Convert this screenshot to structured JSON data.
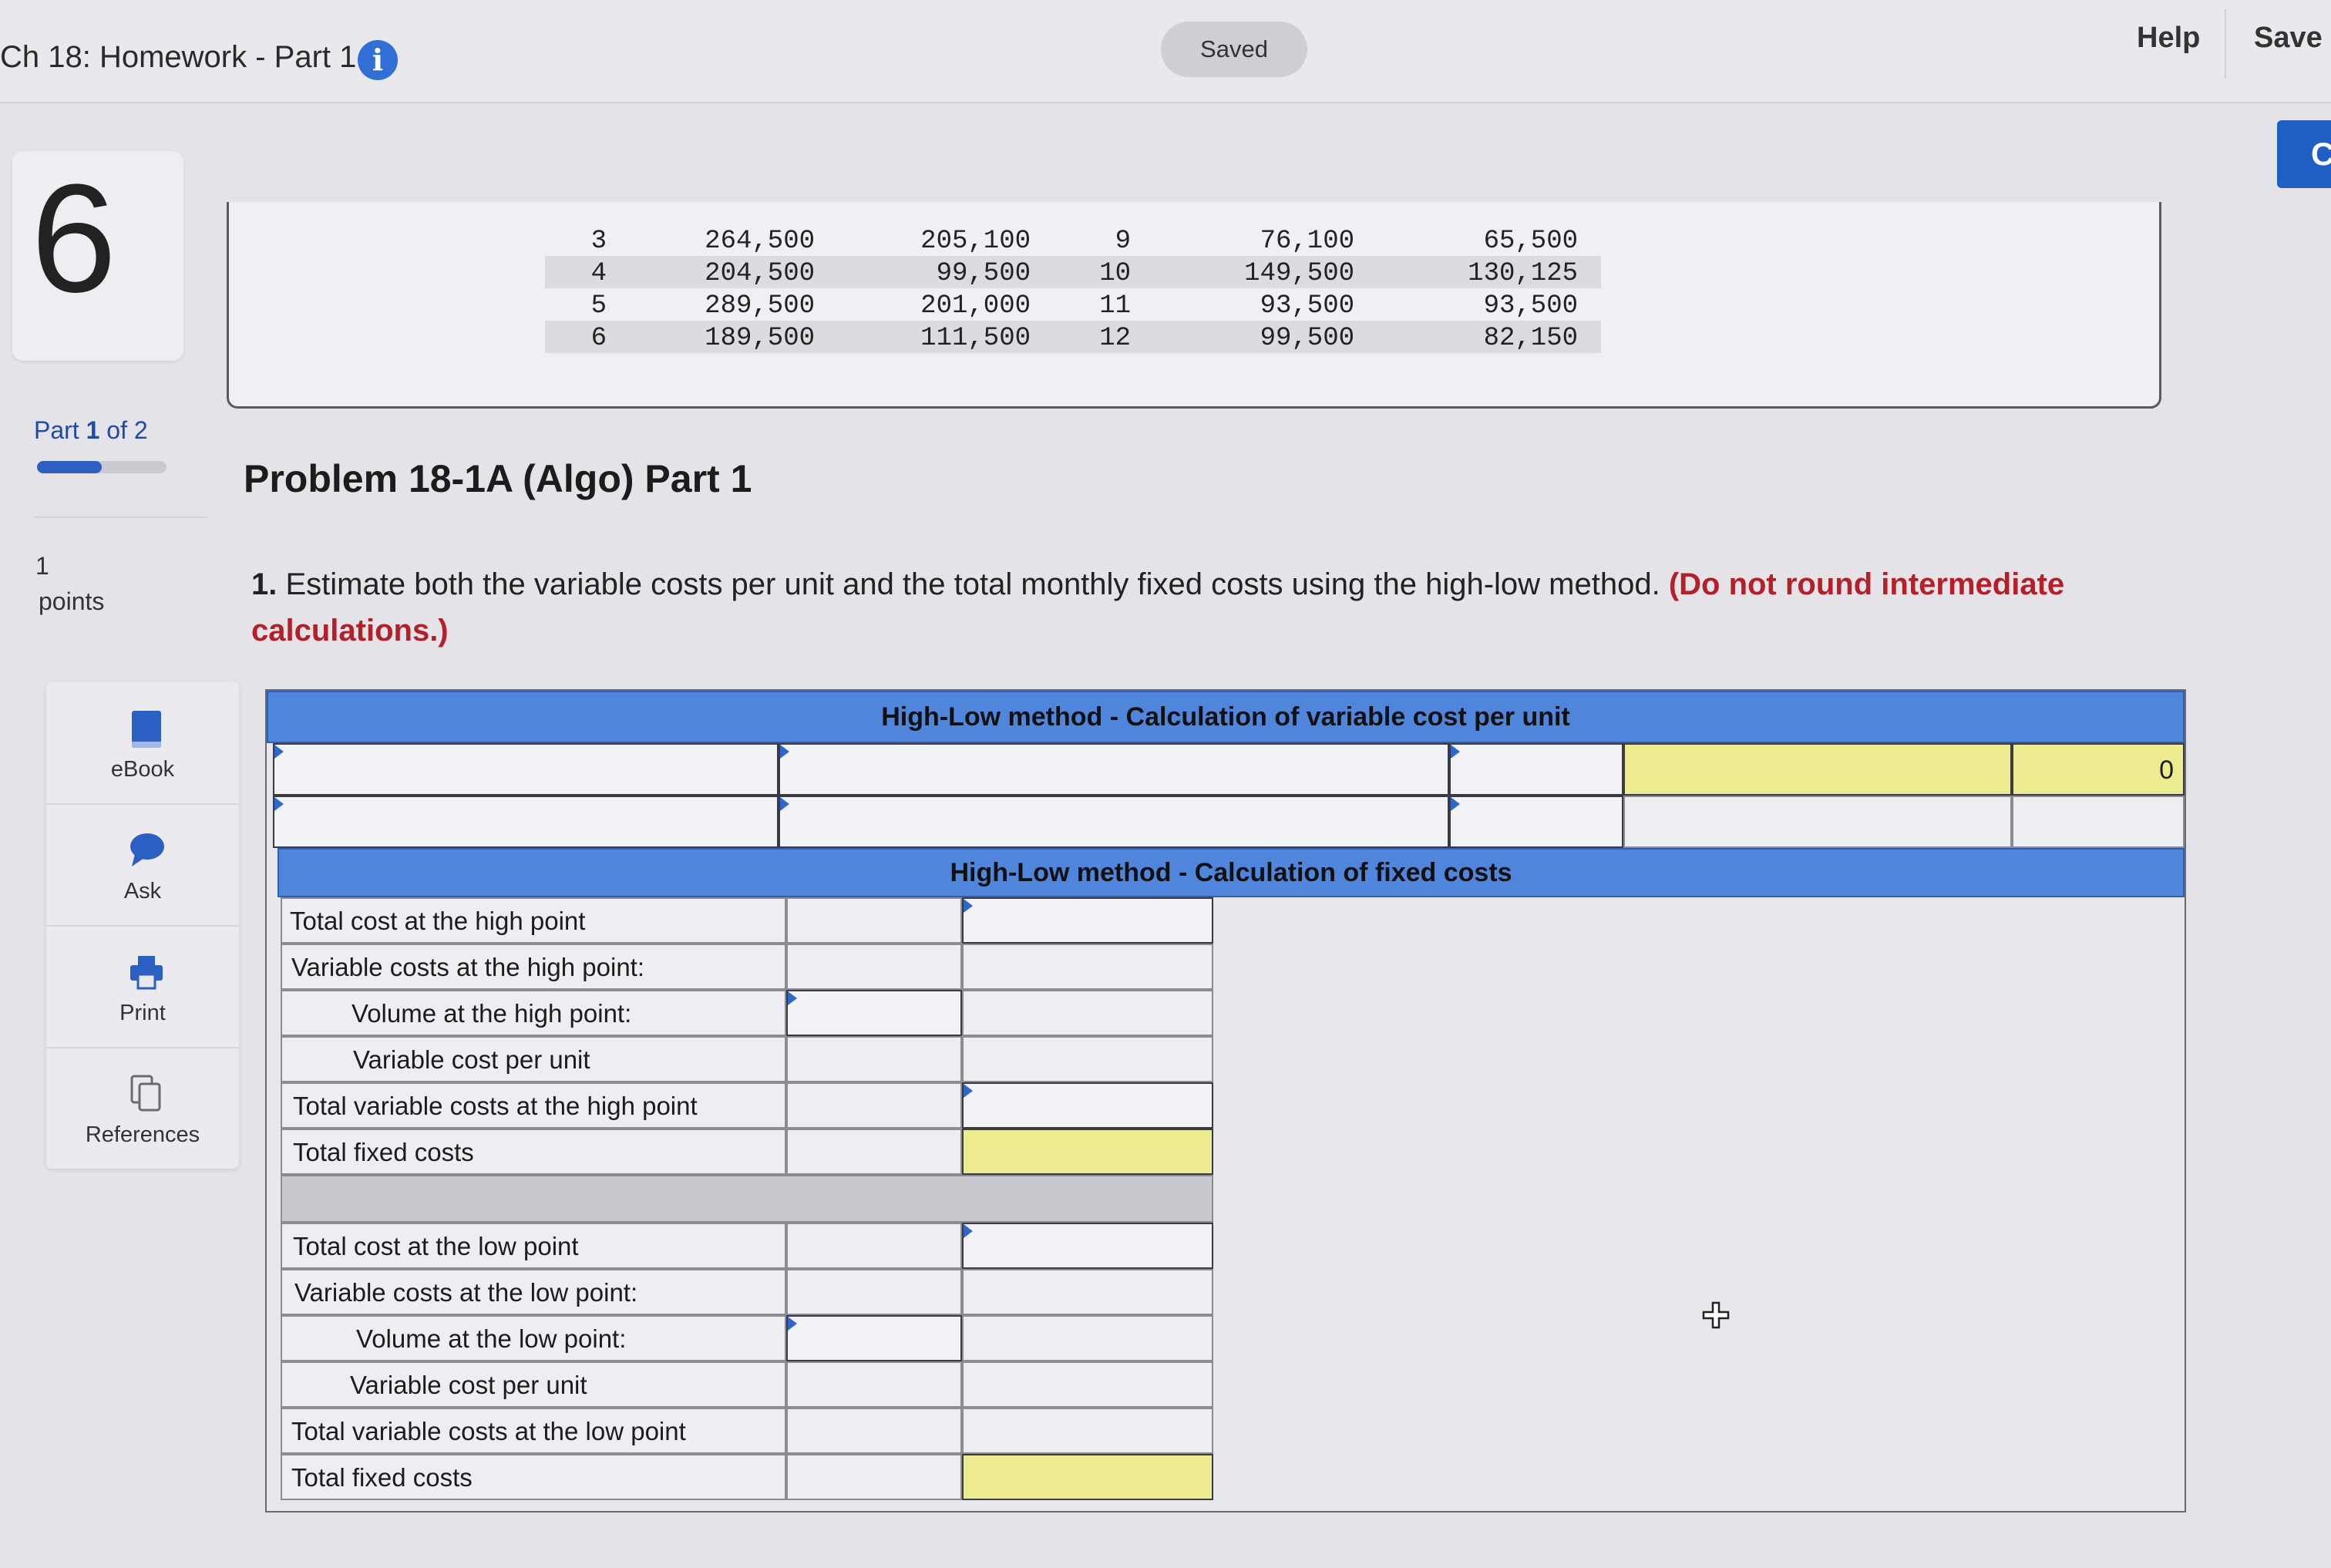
{
  "header": {
    "title": "Ch 18: Homework - Part 1",
    "status": "Saved",
    "help_label": "Help",
    "save_label": "Save",
    "corner_letter": "C"
  },
  "sidebar": {
    "question_number": "6",
    "part_prefix": "Part",
    "part_current": "1",
    "part_of": "of 2",
    "progress_fraction": 0.5,
    "points_value": "1",
    "points_label": "points",
    "tools": [
      {
        "label": "eBook",
        "icon": "ebook-icon"
      },
      {
        "label": "Ask",
        "icon": "ask-icon"
      },
      {
        "label": "Print",
        "icon": "print-icon"
      },
      {
        "label": "References",
        "icon": "references-icon"
      }
    ]
  },
  "data_table": {
    "rows": [
      [
        "3",
        "264,500",
        "205,100",
        "9",
        "76,100",
        "65,500"
      ],
      [
        "4",
        "204,500",
        "99,500",
        "10",
        "149,500",
        "130,125"
      ],
      [
        "5",
        "289,500",
        "201,000",
        "11",
        "93,500",
        "93,500"
      ],
      [
        "6",
        "189,500",
        "111,500",
        "12",
        "99,500",
        "82,150"
      ]
    ]
  },
  "problem": {
    "title": "Problem 18-1A (Algo) Part 1",
    "instruction_number": "1.",
    "instruction_text": "Estimate both the variable costs per unit and the total monthly fixed costs using the high-low method.",
    "instruction_note": "(Do not round intermediate calculations.)"
  },
  "worksheet": {
    "variable_header": "High-Low method - Calculation of variable cost per unit",
    "variable_result": "0",
    "fixed_header": "High-Low method - Calculation of fixed costs",
    "high_rows": [
      "Total cost at the high point",
      "Variable costs at the high point:",
      "Volume at the high point:",
      "Variable cost per unit",
      "Total variable costs at the high point",
      "Total fixed costs"
    ],
    "low_rows": [
      "Total cost at the low point",
      "Variable costs at the low point:",
      "Volume at the low point:",
      "Variable cost per unit",
      "Total variable costs at the low point",
      "Total fixed costs"
    ]
  }
}
